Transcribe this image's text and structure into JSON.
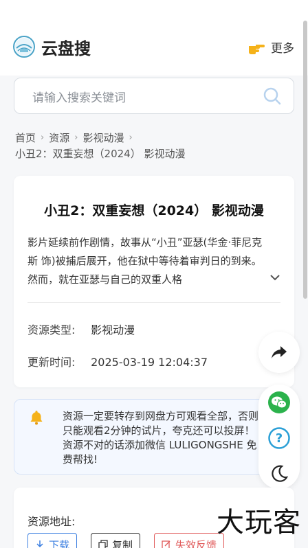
{
  "header": {
    "site_title": "云盘搜",
    "more_label": "更多"
  },
  "search": {
    "placeholder": "请输入搜索关键词"
  },
  "breadcrumb": {
    "items": [
      "首页",
      "资源",
      "影视动漫"
    ],
    "current": "小丑2：双重妄想（2024） 影视动漫"
  },
  "detail": {
    "title": "小丑2：双重妄想（2024） 影视动漫",
    "description": "影片延续前作剧情，故事从“小丑”亚瑟(华金·菲尼克斯 饰)被捕后展开，他在狱中等待着审判日的到来。然而，就在亚瑟与自己的双重人格",
    "type_label": "资源类型:",
    "type_value": "影视动漫",
    "updated_label": "更新时间:",
    "updated_value": "2025-03-19 12:04:37"
  },
  "notice": {
    "text": "资源一定要转存到网盘方可观看全部，否则只能观看2分钟的试片，夸克还可以投屏！资源不对的话添加微信 LULIGONGSHE 免费帮找!"
  },
  "resource": {
    "address_label": "资源地址:",
    "download_label": "下载",
    "copy_label": "复制",
    "report_label": "失效反馈"
  },
  "watermark": "大玩客",
  "colors": {
    "accent": "#3a7ee0",
    "report": "#e05a5a",
    "wechat": "#2bb24c",
    "help": "#2a9fd6"
  }
}
